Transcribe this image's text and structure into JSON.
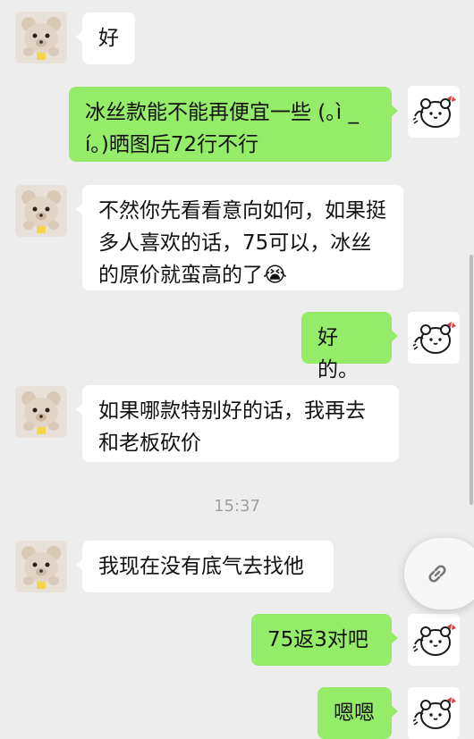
{
  "chat": {
    "timestamp": "15:37",
    "messages": [
      {
        "side": "left",
        "text": "好"
      },
      {
        "side": "right",
        "text": "冰丝款能不能再便宜一些 (｡ì _ í｡)晒图后72行不行"
      },
      {
        "side": "left",
        "text": "不然你先看看意向如何，如果挺多人喜欢的话，75可以，冰丝的原价就蛮高的了😭"
      },
      {
        "side": "right",
        "text": "好的。"
      },
      {
        "side": "left",
        "text": "如果哪款特别好的话，我再去和老板砍价"
      },
      {
        "side": "left",
        "text": "我现在没有底气去找他"
      },
      {
        "side": "right",
        "text": "75返3对吧"
      },
      {
        "side": "right",
        "text": "嗯嗯"
      }
    ]
  },
  "icons": {
    "contact_avatar": "teddy-bear-avatar-icon",
    "self_avatar": "cartoon-bear-avatar-icon",
    "floating_button": "link-icon"
  },
  "colors": {
    "background": "#ededed",
    "self_bubble": "#95ec69",
    "contact_bubble": "#ffffff",
    "timestamp_text": "#a0a0a0"
  }
}
